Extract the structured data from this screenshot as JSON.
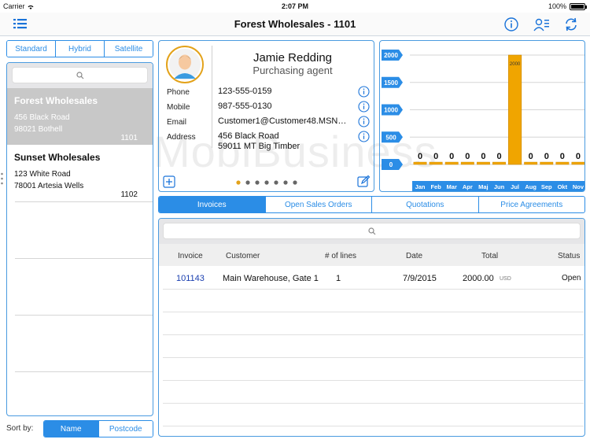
{
  "status": {
    "carrier": "Carrier",
    "time": "2:07 PM",
    "battery": "100%"
  },
  "nav": {
    "title": "Forest Wholesales - 1101",
    "icons": [
      "list-icon",
      "info-icon",
      "contact-card-icon",
      "refresh-icon"
    ]
  },
  "view_modes": [
    "Standard",
    "Hybrid",
    "Satellite"
  ],
  "customers": [
    {
      "name": "Forest Wholesales",
      "address1": "456 Black Road",
      "address2": "98021 Bothell",
      "number": "1101",
      "selected": true
    },
    {
      "name": "Sunset Wholesales",
      "address1": "123 White Road",
      "address2": "78001 Artesia Wells",
      "number": "1102",
      "selected": false
    }
  ],
  "sort": {
    "label": "Sort by:",
    "options": [
      "Name",
      "Postcode"
    ]
  },
  "contact": {
    "name": "Jamie Redding",
    "title": "Purchasing agent",
    "fields": [
      {
        "label": "Phone",
        "value": "123-555-0159"
      },
      {
        "label": "Mobile",
        "value": "987-555-0130"
      },
      {
        "label": "Email",
        "value": "Customer1@Customer48.MSN…"
      },
      {
        "label": "Address",
        "value": "456 Black Road",
        "value2": "59011 MT Big Timber"
      }
    ]
  },
  "watermark": "MobiBusiness",
  "chart_data": {
    "type": "bar",
    "categories": [
      "Jan",
      "Feb",
      "Mar",
      "Apr",
      "Maj",
      "Jun",
      "Jul",
      "Aug",
      "Sep",
      "Okt",
      "Nov"
    ],
    "values": [
      0,
      0,
      0,
      0,
      0,
      0,
      2000,
      0,
      0,
      0,
      0
    ],
    "y_ticks": [
      "2000",
      "1500",
      "1000",
      "500",
      "0"
    ],
    "ylim": [
      0,
      2000
    ],
    "bar_color": "#f0a500"
  },
  "tabs": [
    "Invoices",
    "Open Sales Orders",
    "Quotations",
    "Price Agreements"
  ],
  "invoices": {
    "columns": [
      "Invoice",
      "Customer",
      "# of lines",
      "Date",
      "Total",
      "Status"
    ],
    "rows": [
      {
        "invoice": "101143",
        "customer": "Main Warehouse, Gate 1",
        "lines": "1",
        "date": "7/9/2015",
        "total": "2000.00",
        "currency": "USD",
        "status": "Open"
      }
    ]
  },
  "colors": {
    "accent": "#2b8de6",
    "invoice_link": "#1a3fb0"
  }
}
